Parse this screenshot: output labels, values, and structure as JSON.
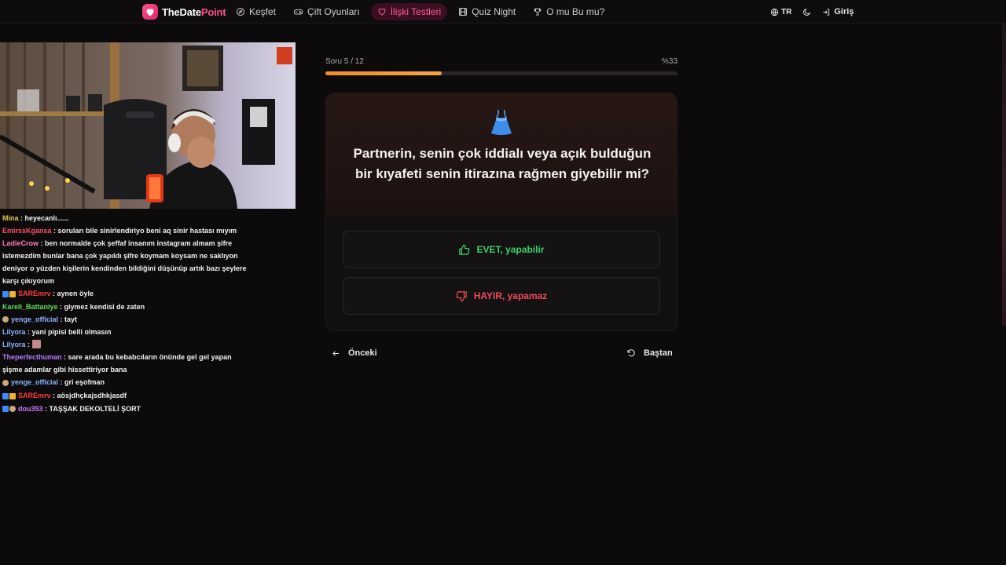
{
  "brand": {
    "part1": "TheDate",
    "part2": "Point",
    "accent": "#ff4f8b"
  },
  "nav": {
    "items": [
      {
        "label": "Keşfet",
        "icon": "compass-icon"
      },
      {
        "label": "Çift Oyunları",
        "icon": "gamepad-icon"
      },
      {
        "label": "İlişki Testleri",
        "icon": "heart-icon",
        "active": true
      },
      {
        "label": "Quiz Night",
        "icon": "film-icon"
      },
      {
        "label": "O mu Bu mu?",
        "icon": "trophy-icon"
      }
    ],
    "language": "TR",
    "login": "Giriş"
  },
  "quiz": {
    "progress_label": "Soru 5 / 12",
    "progress_percent_label": "%33",
    "progress_fraction": 0.33,
    "question_icon": "dress-icon",
    "question": "Partnerin, senin çok iddialı veya açık bulduğun bir kıyafeti senin itirazına rağmen giyebilir mi?",
    "answers": {
      "yes": "EVET, yapabilir",
      "no": "HAYIR, yapamaz"
    },
    "prev_label": "Önceki",
    "restart_label": "Baştan"
  },
  "stream": {
    "chat": [
      {
        "user": "Mina",
        "color": "#e0c24a",
        "text": "heyecanlı......"
      },
      {
        "user": "EmirssKgansa",
        "color": "#ff4f6a",
        "text": "soruları bile sinirlendiriyo beni aq sinir hastası mıyım"
      },
      {
        "user": "LadieCrow",
        "color": "#ff7ab8",
        "text": "ben normalde çok şeffaf insanım instagram almam şifre istemezdim bunlar bana çok yapıldı şifre koymam koysam ne saklıyon deniyor o yüzden kişilerin kendinden bildiğini düşünüp artık bazı şeylere karşı çıkıyorum"
      },
      {
        "user": "SAREmrv",
        "color": "#ff3b3b",
        "text": "aynen öyle"
      },
      {
        "user": "Kareli_Battaniye",
        "color": "#58e05a",
        "text": "giymez kendisi de zaten"
      },
      {
        "user": "yenge_official",
        "color": "#8ab4ff",
        "text": "tayt"
      },
      {
        "user": "Lilyora",
        "color": "#8ab4ff",
        "text": "yani pipisi belli olmasın"
      },
      {
        "user": "Lilyora",
        "color": "#8ab4ff",
        "text": "🖼"
      },
      {
        "user": "Theperfecthuman",
        "color": "#b77cff",
        "text": "sare arada bu kebabcıların önünde gel gel yapan şişme adamlar gibi hissettiriyor bana"
      },
      {
        "user": "yenge_official",
        "color": "#8ab4ff",
        "text": "gri eşofman"
      },
      {
        "user": "SAREmrv",
        "color": "#ff3b3b",
        "text": "aösjdhçkajsdhkjasdf"
      },
      {
        "user": "dou353",
        "color": "#c57bff",
        "text": "TAŞŞAK DEKOLTELİ ŞORT"
      }
    ]
  }
}
